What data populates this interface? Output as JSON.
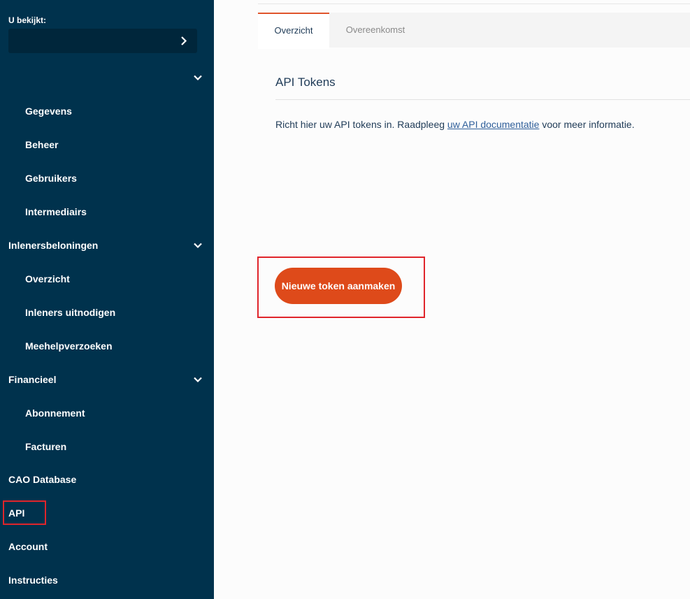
{
  "sidebar": {
    "viewing_label": "U bekijkt:",
    "account_value": "",
    "items": [
      {
        "label": "",
        "type": "section",
        "expandable": true
      },
      {
        "label": "Gegevens",
        "type": "sub"
      },
      {
        "label": "Beheer",
        "type": "sub"
      },
      {
        "label": "Gebruikers",
        "type": "sub"
      },
      {
        "label": "Intermediairs",
        "type": "sub"
      },
      {
        "label": "Inlenersbeloningen",
        "type": "section",
        "expandable": true
      },
      {
        "label": "Overzicht",
        "type": "sub"
      },
      {
        "label": "Inleners uitnodigen",
        "type": "sub"
      },
      {
        "label": "Meehelpverzoeken",
        "type": "sub"
      },
      {
        "label": "Financieel",
        "type": "section",
        "expandable": true
      },
      {
        "label": "Abonnement",
        "type": "sub"
      },
      {
        "label": "Facturen",
        "type": "sub"
      },
      {
        "label": "CAO Database",
        "type": "section"
      },
      {
        "label": "API",
        "type": "section",
        "active": true
      },
      {
        "label": "Account",
        "type": "section"
      },
      {
        "label": "Instructies",
        "type": "section"
      }
    ],
    "icons": {
      "account_select": "chevron-right-icon",
      "expand": "chevron-down-icon"
    }
  },
  "main": {
    "tabs": [
      {
        "label": "Overzicht",
        "active": true
      },
      {
        "label": "Overeenkomst",
        "active": false
      }
    ],
    "title": "API Tokens",
    "intro_before": "Richt hier uw API tokens in. Raadpleeg ",
    "intro_link": "uw API documentatie",
    "intro_after": " voor meer informatie.",
    "new_token_button": "Nieuwe token aanmaken"
  },
  "colors": {
    "sidebar_bg": "#00324d",
    "accent": "#de4a1a",
    "highlight": "#e0252b"
  }
}
